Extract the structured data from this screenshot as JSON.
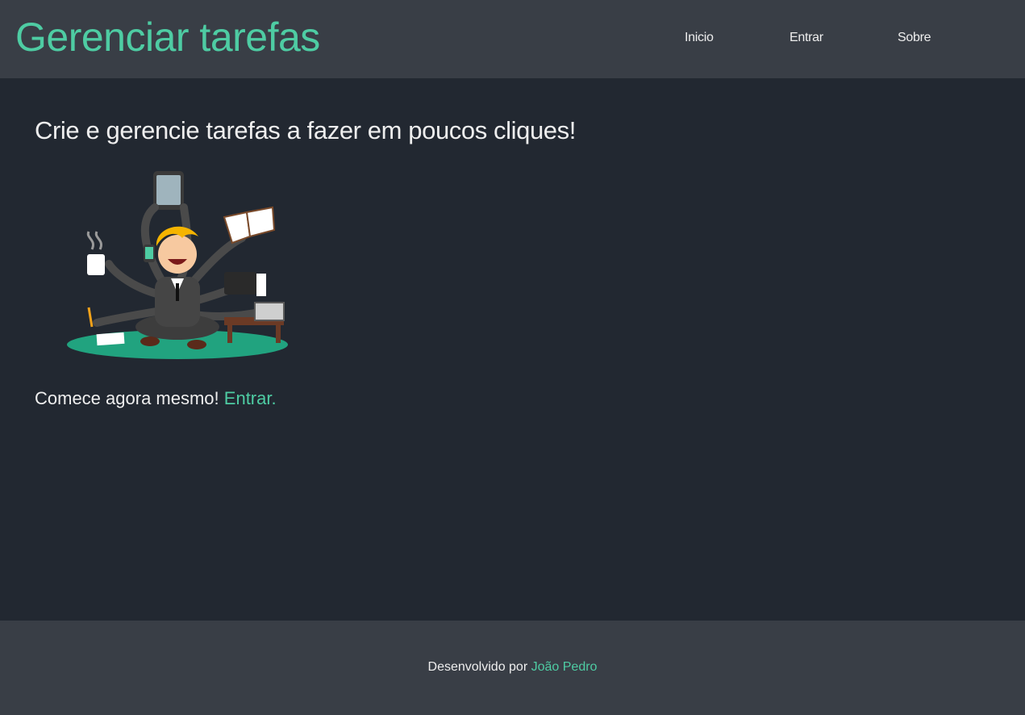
{
  "header": {
    "brand": "Gerenciar tarefas",
    "nav": [
      {
        "label": "Inicio"
      },
      {
        "label": "Entrar"
      },
      {
        "label": "Sobre"
      }
    ]
  },
  "main": {
    "headline": "Crie e gerencie tarefas a fazer em poucos cliques!",
    "illustration_icon": "multitasking-businessman-illustration",
    "cta_text": "Comece agora mesmo!",
    "cta_link": "Entrar."
  },
  "footer": {
    "prefix": "Desenvolvido por",
    "author": "João Pedro"
  },
  "colors": {
    "background": "#222831",
    "header_footer": "#393e46",
    "accent": "#4ecca3",
    "text": "#eeeeee"
  }
}
